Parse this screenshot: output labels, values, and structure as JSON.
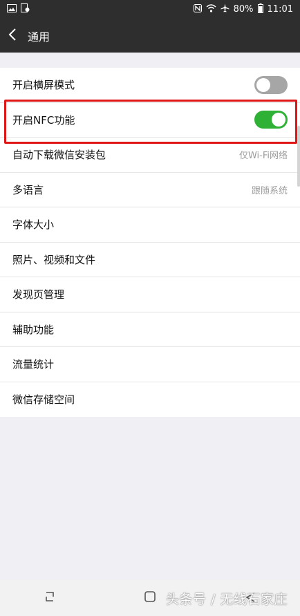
{
  "status_bar": {
    "battery": "80%",
    "time": "11:01",
    "icons": [
      "image-icon",
      "notification-icon",
      "nfc-icon",
      "wifi-icon",
      "airplane-icon",
      "battery-icon"
    ]
  },
  "header": {
    "title": "通用",
    "back_icon": "chevron-left-icon"
  },
  "settings": {
    "items": [
      {
        "label": "开启横屏模式",
        "type": "toggle",
        "on": false
      },
      {
        "label": "开启NFC功能",
        "type": "toggle",
        "on": true,
        "highlighted": true
      },
      {
        "label": "自动下载微信安装包",
        "type": "value",
        "value": "仅Wi-Fi网络"
      },
      {
        "label": "多语言",
        "type": "value",
        "value": "跟随系统"
      },
      {
        "label": "字体大小",
        "type": "link"
      },
      {
        "label": "照片、视频和文件",
        "type": "link"
      },
      {
        "label": "发现页管理",
        "type": "link"
      },
      {
        "label": "辅助功能",
        "type": "link"
      },
      {
        "label": "流量统计",
        "type": "link"
      },
      {
        "label": "微信存储空间",
        "type": "link"
      }
    ]
  },
  "colors": {
    "header_bg": "#2e2e2e",
    "toggle_on": "#2eb135",
    "toggle_off": "#a6a6a6",
    "highlight": "#e01515"
  },
  "nav_bar": {
    "icons": [
      "recent-apps-icon",
      "home-icon",
      "back-icon"
    ]
  },
  "watermark": "头条号 / 无线石家庄"
}
